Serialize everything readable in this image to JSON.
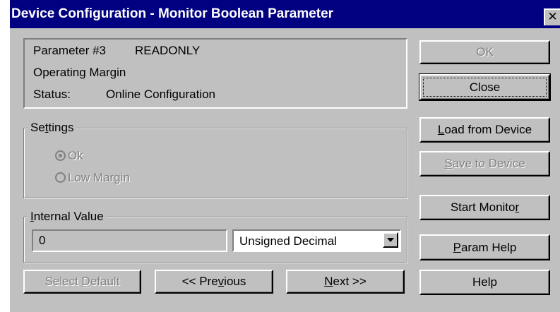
{
  "window": {
    "title": "Device Configuration - Monitor Boolean Parameter",
    "close_glyph": "✕"
  },
  "info": {
    "parameter_label": "Parameter #3",
    "access_label": "READONLY",
    "name": "Operating Margin",
    "status_label": "Status:",
    "status_value": "Online Configuration"
  },
  "settings": {
    "group_label_pre": "Se",
    "group_label_key": "t",
    "group_label_post": "tings",
    "options": [
      {
        "label": "Ok",
        "selected": true,
        "enabled": false
      },
      {
        "label": "Low Margin",
        "selected": false,
        "enabled": false
      }
    ]
  },
  "internal_value": {
    "group_label_key": "I",
    "group_label_post": "nternal Value",
    "value": "0",
    "format_selected": "Unsigned Decimal"
  },
  "buttons": {
    "ok": "OK",
    "close": "Close",
    "load_key": "L",
    "load_post": "oad from Device",
    "save_key": "S",
    "save_post": "ave to Device",
    "start_monitor_pre": "Start Monito",
    "start_monitor_key": "r",
    "param_help_key": "P",
    "param_help_post": "aram Help",
    "select_default_pre": "Select ",
    "select_default_key": "D",
    "select_default_post": "efault",
    "previous_pre": "<< Pre",
    "previous_key": "v",
    "previous_post": "ious",
    "next_key": "N",
    "next_post": "ext >>",
    "help": "Help"
  },
  "colors": {
    "title_bar": "#000080",
    "face": "#c0c0c0",
    "disabled_text": "#808080"
  }
}
